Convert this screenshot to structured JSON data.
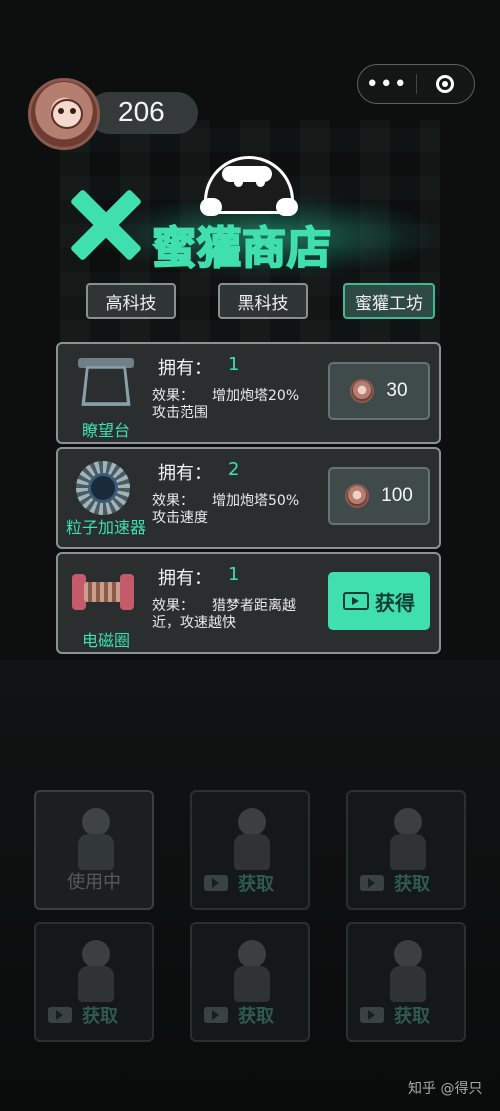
{
  "hud": {
    "coins": "206",
    "more_glyph": "•••",
    "close_glyph": "◎"
  },
  "shop": {
    "title": "蜜獾商店"
  },
  "tabs": [
    {
      "label": "高科技",
      "active": false
    },
    {
      "label": "黑科技",
      "active": false
    },
    {
      "label": "蜜獾工坊",
      "active": true
    }
  ],
  "items": [
    {
      "name": "瞭望台",
      "owned_label": "拥有：",
      "owned": "1",
      "effect_label": "效果：",
      "effect_line1": "增加炮塔20%",
      "effect_line2": "攻击范围",
      "price": "30"
    },
    {
      "name": "粒子加速器",
      "owned_label": "拥有：",
      "owned": "2",
      "effect_label": "效果：",
      "effect_line1": "增加炮塔50%",
      "effect_line2": "攻击速度",
      "price": "100"
    },
    {
      "name": "电磁圈",
      "owned_label": "拥有：",
      "owned": "1",
      "effect_label": "效果：",
      "effect_line1": "猎梦者距离越",
      "effect_line2": "近，攻速越快",
      "button_label": "获得"
    }
  ],
  "characters": [
    {
      "status": "使用中"
    },
    {
      "status": "获取"
    },
    {
      "status": "获取"
    },
    {
      "status": "获取"
    },
    {
      "status": "获取"
    },
    {
      "status": "获取"
    }
  ],
  "watermark": "知乎 @得只",
  "colors": {
    "accent": "#3fe0ae",
    "card_bg": "#2a2e2e",
    "background": "#0d0f0f"
  }
}
